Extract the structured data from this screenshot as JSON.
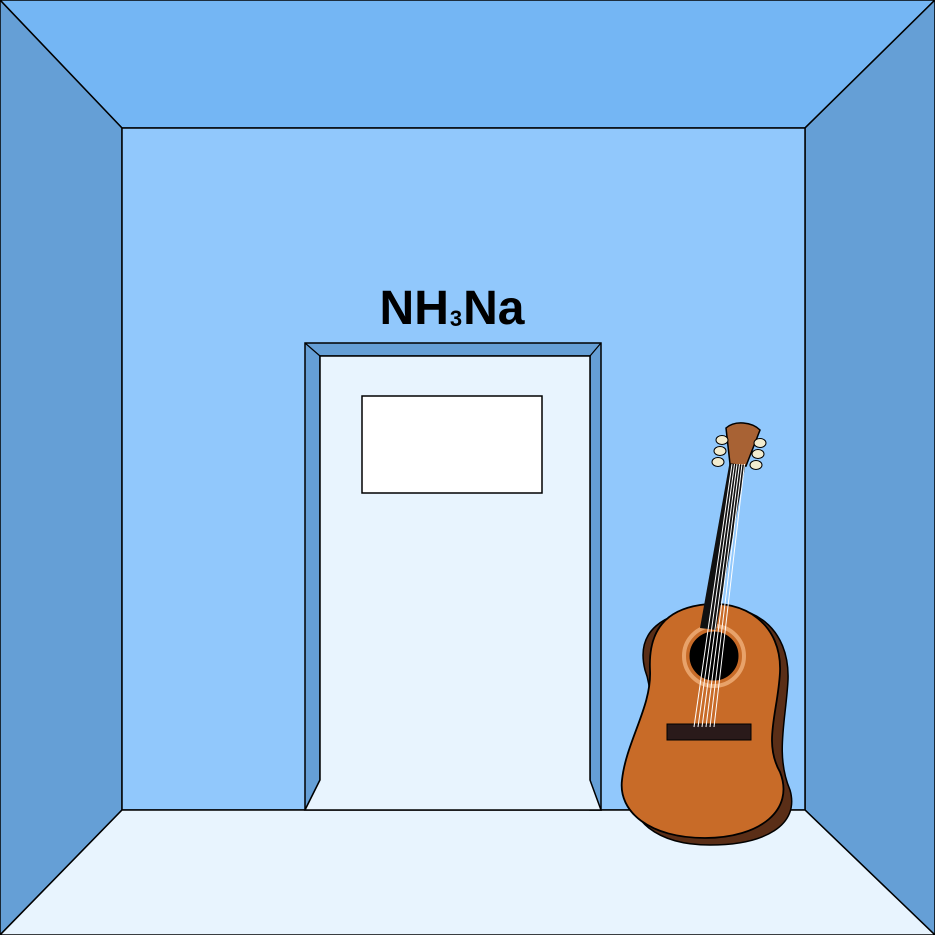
{
  "room": {
    "colors": {
      "ceiling": "#74b6f4",
      "side_wall": "#659fd6",
      "back_wall": "#91c8fc",
      "floor": "#e8f4fe",
      "door_panel": "#e8f4fe",
      "door_frame": "#659fd6",
      "outline": "#000000"
    }
  },
  "door": {
    "sign": {
      "prefix": "NH",
      "subscript": "3",
      "suffix": "Na"
    }
  },
  "guitar": {
    "colors": {
      "body": "#c86b28",
      "body_shadow": "#5a2e17",
      "headstock": "#a86234",
      "bridge": "#2a1a1a",
      "soundhole": "#000000",
      "rosette": "#e8a26a",
      "pegs": "#f2eccf",
      "neck": "#111111"
    }
  }
}
